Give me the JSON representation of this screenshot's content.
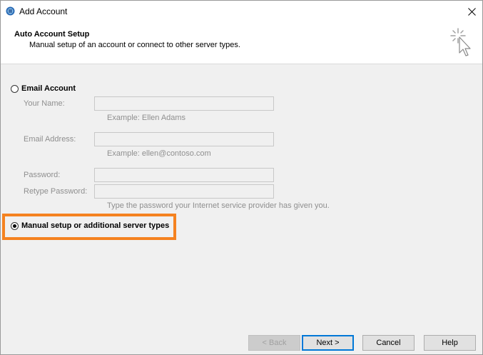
{
  "window": {
    "title": "Add Account"
  },
  "header": {
    "title": "Auto Account Setup",
    "subtitle": "Manual setup of an account or connect to other server types.",
    "icon": "cursor-sparkle-icon"
  },
  "email_account": {
    "label": "Email Account",
    "selected": false,
    "fields": {
      "name": {
        "label": "Your Name:",
        "value": "",
        "hint": "Example: Ellen Adams"
      },
      "email": {
        "label": "Email Address:",
        "value": "",
        "hint": "Example: ellen@contoso.com"
      },
      "password": {
        "label": "Password:",
        "value": ""
      },
      "retype_password": {
        "label": "Retype Password:",
        "value": "",
        "hint": "Type the password your Internet service provider has given you."
      }
    }
  },
  "manual_setup": {
    "label": "Manual setup or additional server types",
    "selected": true
  },
  "buttons": {
    "back": "< Back",
    "next": "Next >",
    "cancel": "Cancel",
    "help": "Help"
  },
  "colors": {
    "highlight": "#f58220",
    "default_button_border": "#0078d7"
  }
}
